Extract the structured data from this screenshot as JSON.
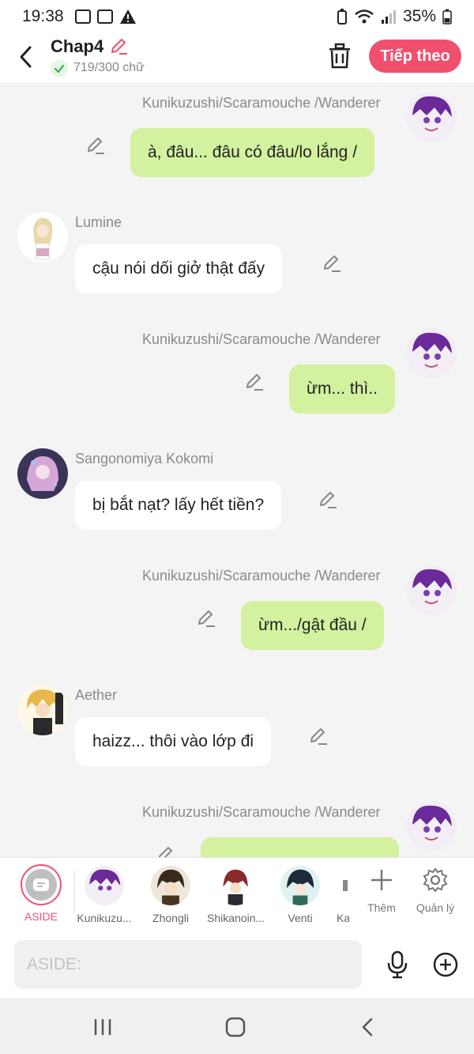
{
  "status": {
    "time": "19:38",
    "battery": "35%"
  },
  "header": {
    "title": "Chap4",
    "char_count": "719/300 chữ",
    "next_label": "Tiếp theo"
  },
  "messages": [
    {
      "side": "right",
      "name": "Kunikuzushi/Scaramouche /Wanderer",
      "text": "à, đâu... đâu có đâu/lo lắng /",
      "avatar": "scaramouche"
    },
    {
      "side": "left",
      "name": "Lumine",
      "text": "cậu nói dối giở thật đấy",
      "avatar": "lumine"
    },
    {
      "side": "right",
      "name": "Kunikuzushi/Scaramouche /Wanderer",
      "text": "ừm... thì..",
      "avatar": "scaramouche"
    },
    {
      "side": "left",
      "name": "Sangonomiya Kokomi",
      "text": "bị bắt nạt? lấy hết tiền?",
      "avatar": "kokomi"
    },
    {
      "side": "right",
      "name": "Kunikuzushi/Scaramouche /Wanderer",
      "text": "ừm.../gật đầu /",
      "avatar": "scaramouche"
    },
    {
      "side": "left",
      "name": "Aether",
      "text": "haizz... thôi vào lớp đi",
      "avatar": "aether"
    },
    {
      "side": "right",
      "name": "Kunikuzushi/Scaramouche /Wanderer",
      "text": "",
      "avatar": "scaramouche"
    }
  ],
  "charbar": {
    "aside_label": "ASIDE",
    "characters": [
      {
        "label": "Kunikuzu..."
      },
      {
        "label": "Zhongli"
      },
      {
        "label": "Shikanoin..."
      },
      {
        "label": "Venti"
      },
      {
        "label": "Ka"
      }
    ],
    "add_label": "Thêm",
    "manage_label": "Quản lý"
  },
  "input": {
    "placeholder": "ASIDE:"
  },
  "colors": {
    "accent": "#f0506e",
    "bubble_green": "#d3f19e",
    "bubble_white": "#ffffff"
  }
}
